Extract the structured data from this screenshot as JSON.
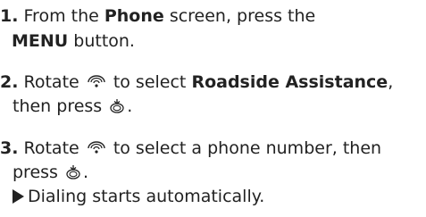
{
  "steps": [
    {
      "number": "1.",
      "line1_prefix": "From the",
      "line1_bold": "Phone",
      "line1_suffix": "screen, press the",
      "line2_bold": "MENU",
      "line2_suffix": "button."
    },
    {
      "number": "2.",
      "line1_prefix": "Rotate",
      "line1_mid": "to select",
      "line1_bold": "Roadside Assistance",
      "line1_suffix": ",",
      "line2_prefix": "then press",
      "line2_suffix": "."
    },
    {
      "number": "3.",
      "line1_prefix": "Rotate",
      "line1_suffix": "to select a phone number, then",
      "line2_prefix": "press",
      "line2_suffix": ".",
      "result": "Dialing starts automatically."
    }
  ],
  "icons": [
    "interface-dial-rotate-icon",
    "interface-dial-press-icon",
    "result-arrow-icon"
  ]
}
